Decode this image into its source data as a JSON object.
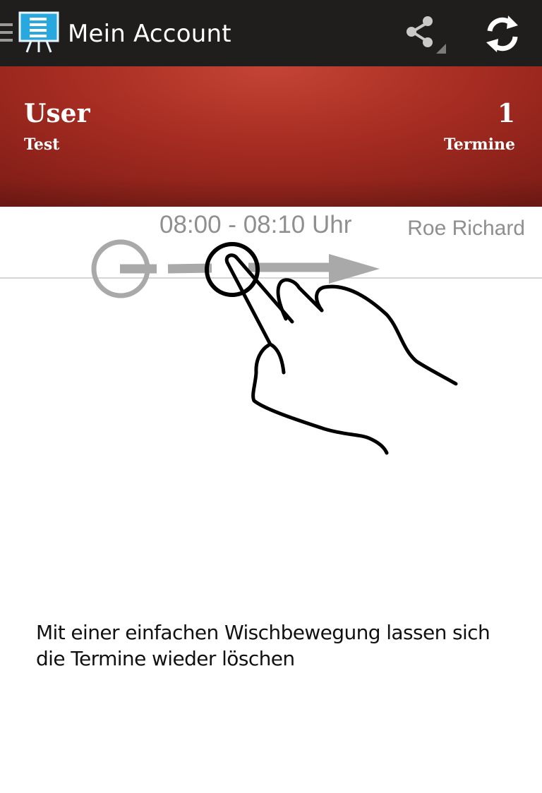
{
  "action_bar": {
    "title": "Mein Account",
    "icons": {
      "drawer": "menu-drawer-icon",
      "app": "presentation-board-icon",
      "share": "share-icon",
      "refresh": "refresh-icon"
    },
    "colors": {
      "background": "#1f1e1d",
      "app_icon": "#29a8e0"
    }
  },
  "profile": {
    "name": "User",
    "subtitle": "Test",
    "count": "1",
    "count_label": "Termine",
    "colors": {
      "gradient_light": "#c44536",
      "gradient_dark": "#7d1c16"
    }
  },
  "appointment": {
    "time": "08:00 - 08:10 Uhr",
    "person": "Roe Richard"
  },
  "gesture": {
    "icons": [
      "swipe-start-circle-icon",
      "swipe-arrow-icon",
      "hand-pointer-icon"
    ],
    "colors": {
      "arrow": "#a9a9a9",
      "hand": "#000000"
    }
  },
  "hint": {
    "text": "Mit einer einfachen Wischbewegung lassen sich die Termine wieder löschen"
  }
}
